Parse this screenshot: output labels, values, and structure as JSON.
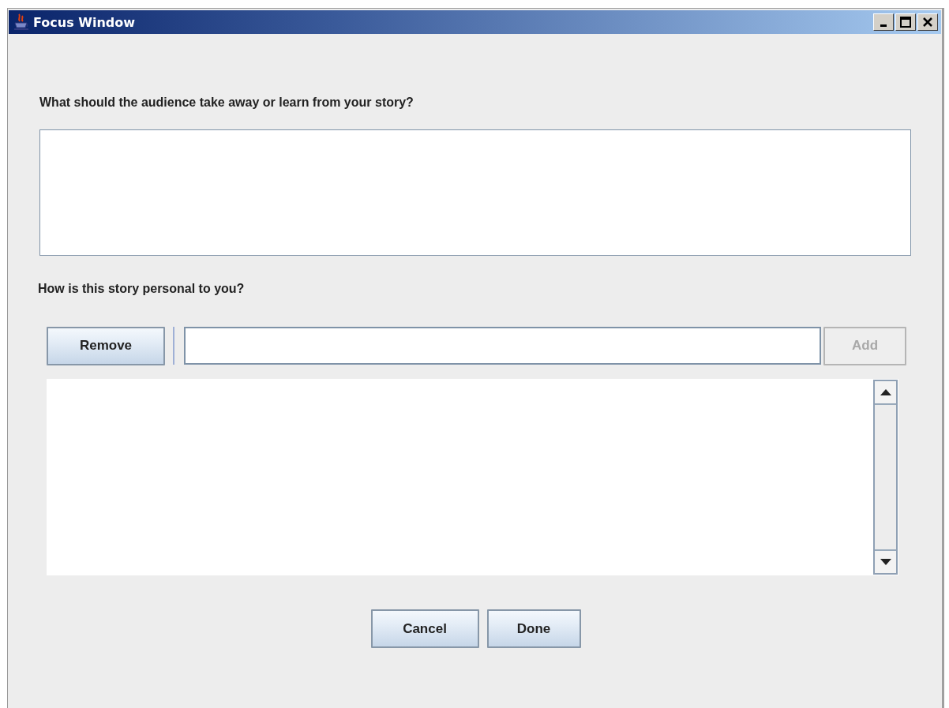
{
  "window": {
    "title": "Focus Window"
  },
  "question_1": {
    "label": "What should the audience take away or learn from your story?"
  },
  "question_2": {
    "label": "How is this story personal to you?"
  },
  "remove_button": {
    "label": "Remove",
    "disabled": false
  },
  "add_button": {
    "label": "Add",
    "disabled": true
  },
  "buttons": [
    {
      "label": "Cancel",
      "disabled": false
    },
    {
      "label": "Done",
      "disabled": false
    }
  ]
}
